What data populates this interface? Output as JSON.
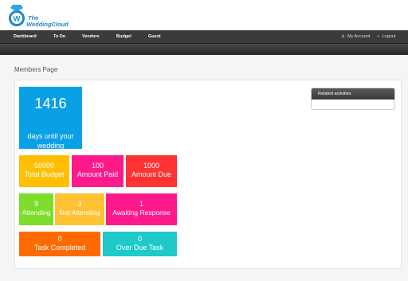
{
  "logo": {
    "line1": "The",
    "line2": "WeddingCloud"
  },
  "nav": {
    "items": [
      "Dashboard",
      "To Do",
      "Vendors",
      "Budget",
      "Guest"
    ],
    "my_account": "My Account",
    "logout": "Logout"
  },
  "page_title": "Members Page",
  "countdown": {
    "value": "1416",
    "label": "days until your wedding"
  },
  "budget": [
    {
      "value": "50000",
      "label": "Total Budget",
      "color": "#ffbf00"
    },
    {
      "value": "100",
      "label": "Amount Paid",
      "color": "#ff1a8c"
    },
    {
      "value": "1000",
      "label": "Amount Due",
      "color": "#ff3333"
    }
  ],
  "guests": [
    {
      "value": "9",
      "label": "Attending",
      "color": "#7ddd2b"
    },
    {
      "value": "3",
      "label": "Not Attending",
      "color": "#ffc233"
    },
    {
      "value": "1",
      "label": "Awaiting Response",
      "color": "#ff1a8c"
    }
  ],
  "tasks": [
    {
      "value": "0",
      "label": "Task Completed",
      "color": "#ff6a00"
    },
    {
      "value": "0",
      "label": "Over Due Task",
      "color": "#1ec9c9"
    }
  ],
  "related": {
    "title": "Related activities"
  },
  "colors": {
    "countdown": "#0aa0e6",
    "nav_bg": "#3b3b3b",
    "brand": "#1e88c8"
  }
}
